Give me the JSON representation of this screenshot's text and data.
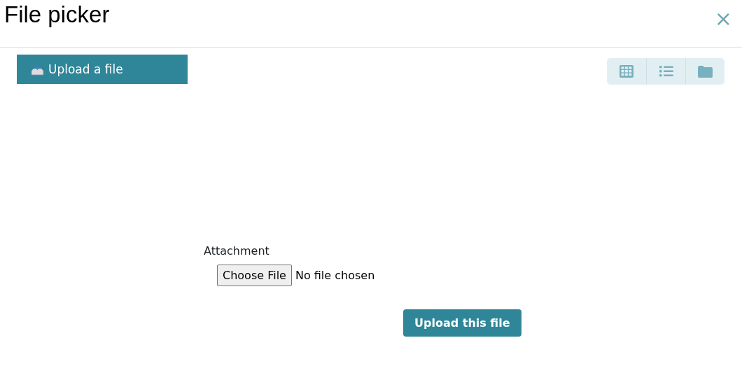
{
  "window": {
    "title": "File picker",
    "close": "×"
  },
  "repositories": [
    {
      "label": "Upload a file"
    }
  ],
  "view_buttons": [
    {
      "kind": "grid"
    },
    {
      "kind": "list"
    },
    {
      "kind": "tree"
    }
  ],
  "form": {
    "label": "Attachment",
    "choose_button": "Choose File",
    "file_status": "No file chosen",
    "submit": "Upload this file"
  }
}
